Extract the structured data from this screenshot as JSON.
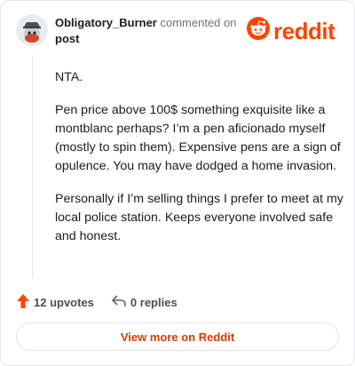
{
  "header": {
    "username": "Obligatory_Burner",
    "action_text": "commented on",
    "post_link": "post",
    "brand_word": "reddit"
  },
  "comment": {
    "paragraphs": [
      "NTA.",
      "Pen price above 100$ something exquisite like a montblanc perhaps? I’m a pen aficionado myself (mostly to spin them). Expensive pens are a sign of opulence. You may have dodged a home invasion.",
      "Personally if I’m selling things I prefer to meet at my local police station. Keeps everyone involved safe and honest."
    ]
  },
  "footer": {
    "upvotes": "12 upvotes",
    "replies": "0 replies",
    "view_more": "View more on Reddit"
  },
  "colors": {
    "brand": "#ff4500",
    "accent_text": "#d93a00",
    "border": "#e4e7ea"
  },
  "icons": [
    "avatar",
    "reddit-logo-icon",
    "upvote-arrow-icon",
    "reply-icon"
  ]
}
